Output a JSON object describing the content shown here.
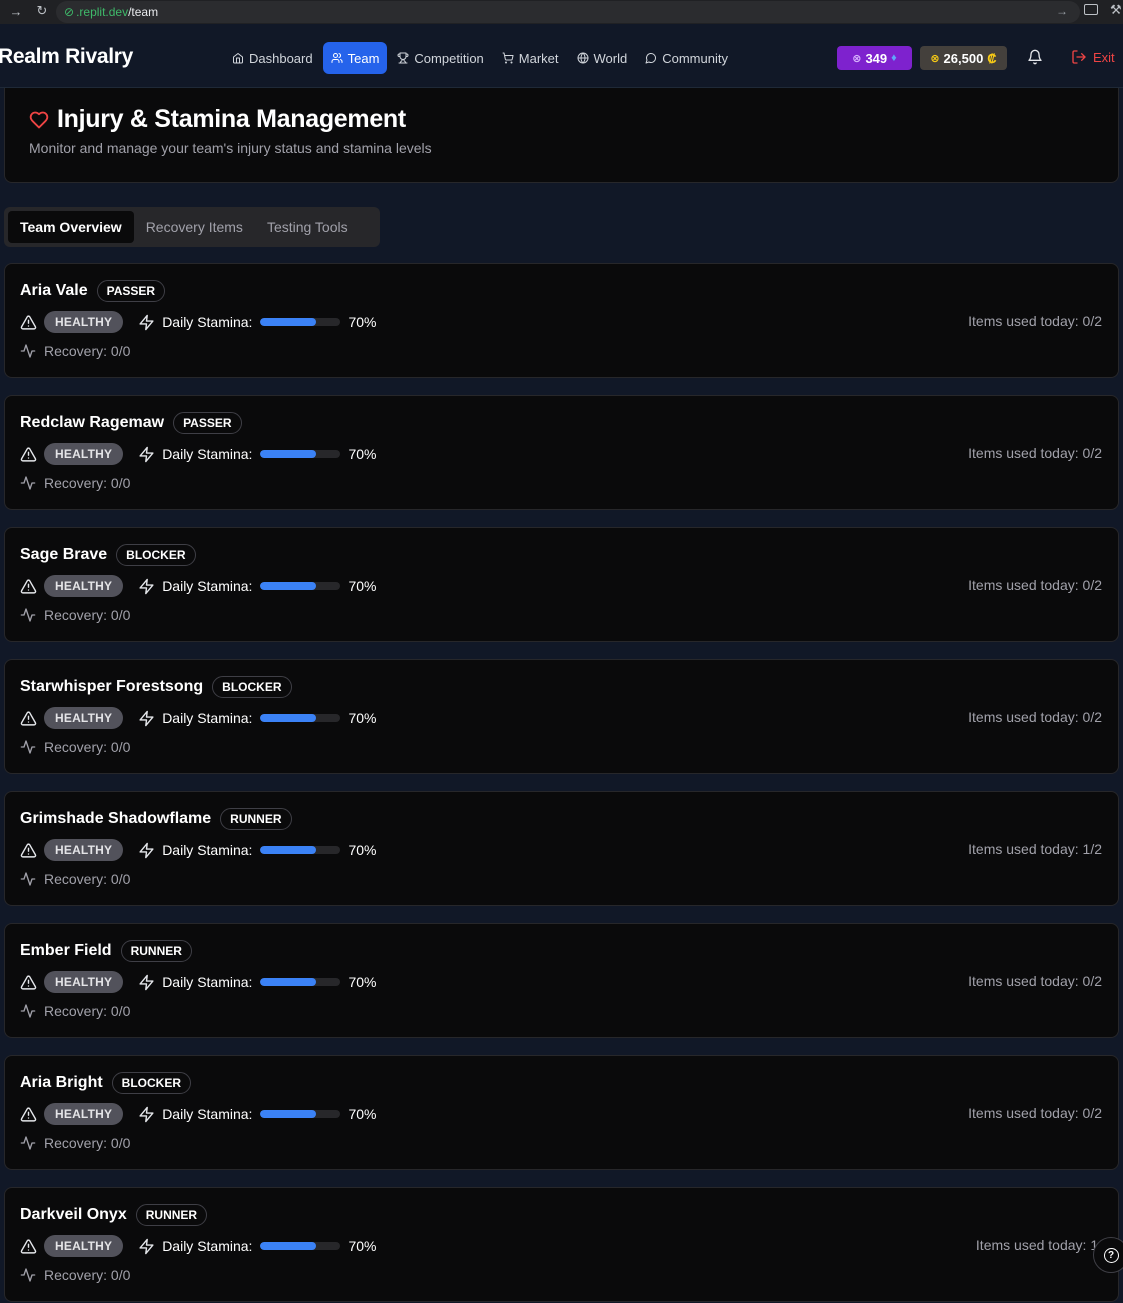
{
  "browser": {
    "url_host": ".replit.dev",
    "url_path": "/team"
  },
  "header": {
    "brand": "Realm Rivalry",
    "nav": [
      {
        "label": "Dashboard",
        "icon": "home-icon",
        "active": false
      },
      {
        "label": "Team",
        "icon": "users-icon",
        "active": true
      },
      {
        "label": "Competition",
        "icon": "trophy-icon",
        "active": false
      },
      {
        "label": "Market",
        "icon": "cart-icon",
        "active": false
      },
      {
        "label": "World",
        "icon": "globe-icon",
        "active": false
      },
      {
        "label": "Community",
        "icon": "chat-icon",
        "active": false
      }
    ],
    "gems": "349",
    "credits": "26,500",
    "credit_symbol": "₡",
    "exit_label": "Exit"
  },
  "hero": {
    "title": "Injury & Stamina Management",
    "subtitle": "Monitor and manage your team's injury status and stamina levels"
  },
  "tabs": [
    "Team Overview",
    "Recovery Items",
    "Testing Tools"
  ],
  "labels": {
    "daily_stamina": "Daily Stamina:",
    "recovery": "Recovery: 0/0"
  },
  "players": [
    {
      "name": "Aria Vale",
      "position": "PASSER",
      "status": "HEALTHY",
      "stamina": "70%",
      "stamina_level": 0.7,
      "recovery": "Recovery: 0/0",
      "items_used": "Items used today: 0/2"
    },
    {
      "name": "Redclaw Ragemaw",
      "position": "PASSER",
      "status": "HEALTHY",
      "stamina": "70%",
      "stamina_level": 0.7,
      "recovery": "Recovery: 0/0",
      "items_used": "Items used today: 0/2"
    },
    {
      "name": "Sage Brave",
      "position": "BLOCKER",
      "status": "HEALTHY",
      "stamina": "70%",
      "stamina_level": 0.7,
      "recovery": "Recovery: 0/0",
      "items_used": "Items used today: 0/2"
    },
    {
      "name": "Starwhisper Forestsong",
      "position": "BLOCKER",
      "status": "HEALTHY",
      "stamina": "70%",
      "stamina_level": 0.7,
      "recovery": "Recovery: 0/0",
      "items_used": "Items used today: 0/2"
    },
    {
      "name": "Grimshade Shadowflame",
      "position": "RUNNER",
      "status": "HEALTHY",
      "stamina": "70%",
      "stamina_level": 0.7,
      "recovery": "Recovery: 0/0",
      "items_used": "Items used today: 1/2"
    },
    {
      "name": "Ember Field",
      "position": "RUNNER",
      "status": "HEALTHY",
      "stamina": "70%",
      "stamina_level": 0.7,
      "recovery": "Recovery: 0/0",
      "items_used": "Items used today: 0/2"
    },
    {
      "name": "Aria Bright",
      "position": "BLOCKER",
      "status": "HEALTHY",
      "stamina": "70%",
      "stamina_level": 0.7,
      "recovery": "Recovery: 0/0",
      "items_used": "Items used today: 0/2"
    },
    {
      "name": "Darkveil Onyx",
      "position": "RUNNER",
      "status": "HEALTHY",
      "stamina": "70%",
      "stamina_level": 0.7,
      "recovery": "Recovery: 0/0",
      "items_used": "Items used today: 1/"
    }
  ],
  "colors": {
    "accent": "#2563eb",
    "gems_bg": "#7e22ce",
    "stamina_fill": "#3b82f6",
    "danger": "#ef4444"
  }
}
